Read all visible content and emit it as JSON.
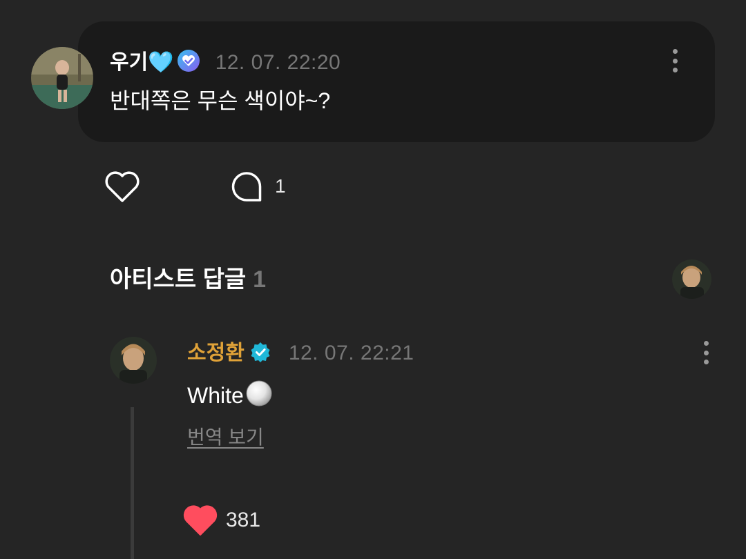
{
  "post": {
    "author_name": "우기",
    "author_emoji": "🩵",
    "timestamp": "12. 07. 22:20",
    "text": "반대쪽은 무슨 색이야~?",
    "reply_count": "1"
  },
  "artist_section": {
    "title": "아티스트 답글",
    "count": "1"
  },
  "reply": {
    "author_name": "소정환",
    "timestamp": "12. 07. 22:21",
    "text": "White",
    "translate_label": "번역 보기",
    "like_count": "381"
  },
  "colors": {
    "background": "#252525",
    "bubble": "#1a1a1a",
    "artist_name": "#e0a238",
    "verified_badge": "#20b8d8",
    "heart_filled": "#ff4d5e",
    "muted_text": "#777777"
  },
  "icons": [
    "more-vertical-icon",
    "heart-outline-icon",
    "comment-bubble-icon",
    "heart-filled-icon",
    "verified-badge-icon",
    "white-circle-emoji"
  ]
}
